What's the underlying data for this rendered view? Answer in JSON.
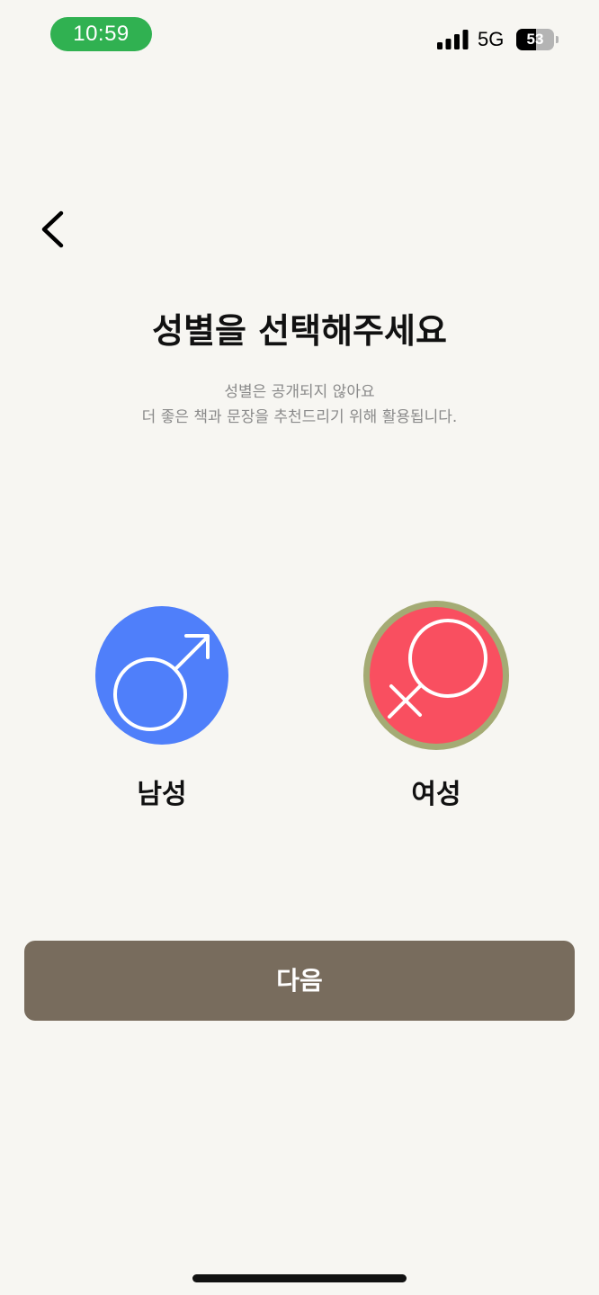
{
  "status_bar": {
    "time": "10:59",
    "network": "5G",
    "battery_level": "53",
    "battery_fraction": 0.53,
    "time_pill_color": "#30b151"
  },
  "header": {
    "back_icon": "chevron-left-icon"
  },
  "content": {
    "title": "성별을 선택해주세요",
    "subtitle_line1": "성별은 공개되지 않아요",
    "subtitle_line2": "더 좋은 책과 문장을 추천드리기 위해 활용됩니다."
  },
  "options": {
    "male": {
      "label": "남성",
      "icon": "male-symbol-icon",
      "color": "#4f7ffa",
      "selected": false
    },
    "female": {
      "label": "여성",
      "icon": "female-symbol-icon",
      "color": "#f94f60",
      "selected": true,
      "selected_ring_color": "#a4ab74"
    }
  },
  "next_button": {
    "label": "다음",
    "color": "#786c5d"
  }
}
